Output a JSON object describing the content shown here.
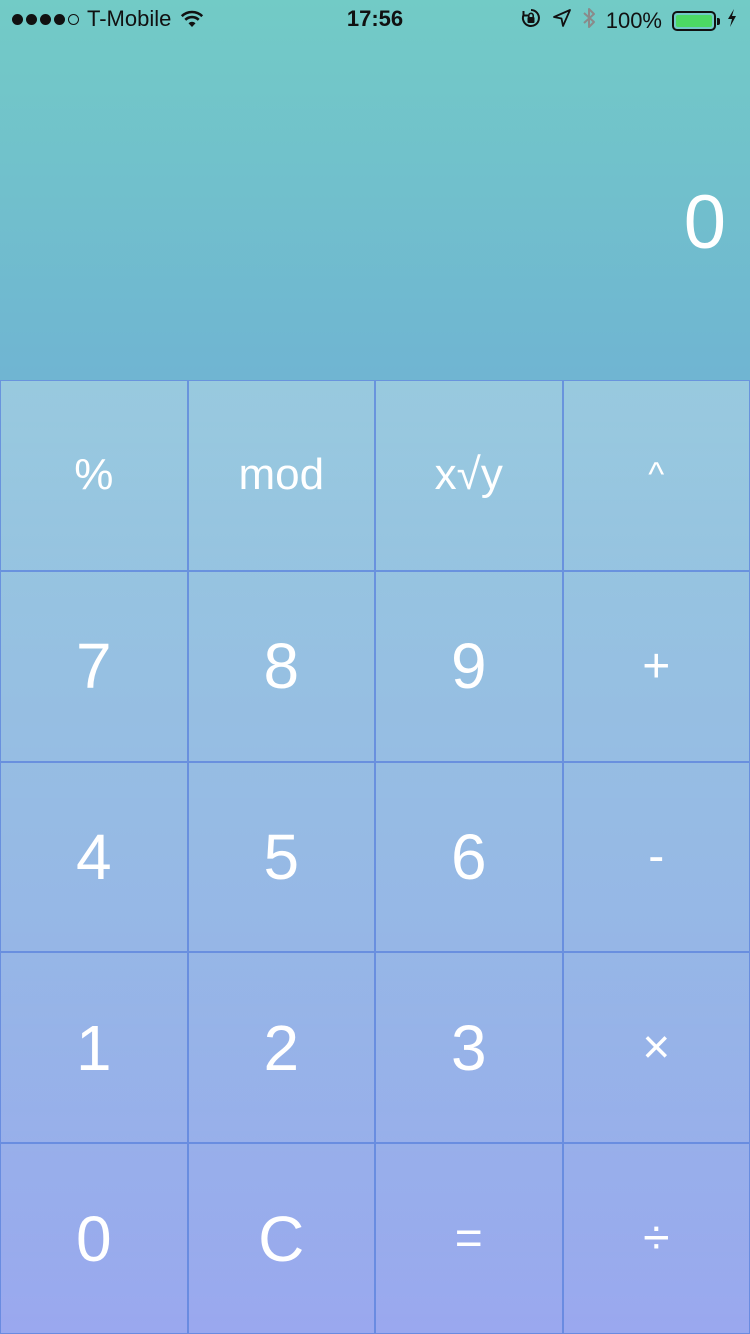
{
  "status_bar": {
    "carrier": "T-Mobile",
    "time": "17:56",
    "battery_percent": "100%",
    "signal_bars": 4,
    "icons": [
      "signal-icon",
      "wifi-icon",
      "orientation-lock-icon",
      "location-icon",
      "bluetooth-icon",
      "battery-icon",
      "charging-icon"
    ],
    "battery_color": "#4cd964"
  },
  "display": {
    "value": "0"
  },
  "keypad": {
    "rows": [
      [
        {
          "label": "%",
          "name": "percent-key"
        },
        {
          "label": "mod",
          "name": "mod-key"
        },
        {
          "label": "x√y",
          "name": "root-key"
        },
        {
          "label": "^",
          "name": "power-key"
        }
      ],
      [
        {
          "label": "7",
          "name": "digit-7-key"
        },
        {
          "label": "8",
          "name": "digit-8-key"
        },
        {
          "label": "9",
          "name": "digit-9-key"
        },
        {
          "label": "+",
          "name": "add-key"
        }
      ],
      [
        {
          "label": "4",
          "name": "digit-4-key"
        },
        {
          "label": "5",
          "name": "digit-5-key"
        },
        {
          "label": "6",
          "name": "digit-6-key"
        },
        {
          "label": "-",
          "name": "subtract-key"
        }
      ],
      [
        {
          "label": "1",
          "name": "digit-1-key"
        },
        {
          "label": "2",
          "name": "digit-2-key"
        },
        {
          "label": "3",
          "name": "digit-3-key"
        },
        {
          "label": "×",
          "name": "multiply-key"
        }
      ],
      [
        {
          "label": "0",
          "name": "digit-0-key"
        },
        {
          "label": "C",
          "name": "clear-key"
        },
        {
          "label": "=",
          "name": "equals-key"
        },
        {
          "label": "÷",
          "name": "divide-key"
        }
      ]
    ]
  },
  "colors": {
    "gradient_top": "#72cbc6",
    "gradient_bottom": "#9aa8ef",
    "key_border": "#5a82dc",
    "text": "#ffffff"
  }
}
